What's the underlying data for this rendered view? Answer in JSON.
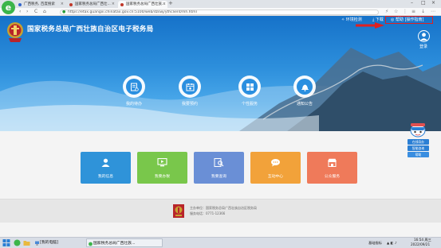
{
  "browser": {
    "tabs": [
      {
        "label": "广西税务, 百度搜索"
      },
      {
        "label": "国家税务总局广西壮..."
      },
      {
        "label": "国家税务总局广西壮族..."
      }
    ],
    "new_tab_glyph": "+",
    "url": "https://etax.guangxi.chinatax.gov.cn:5100/web/dzswj/ythclient/mh.html",
    "nav_back": "‹",
    "nav_forward": "›",
    "nav_reload": "C",
    "nav_home": "⌂"
  },
  "site": {
    "title": "国家税务总局广西壮族自治区电子税务局",
    "topnav": {
      "env_check": "环境检测",
      "download": "下载",
      "help": "帮助",
      "guide": "[操作指南]"
    },
    "login_label": "登录",
    "features": [
      {
        "label": "我的待办",
        "icon": "todo-list-icon"
      },
      {
        "label": "我要预约",
        "icon": "calendar-icon"
      },
      {
        "label": "个性服务",
        "icon": "grid-icon"
      },
      {
        "label": "通知公告",
        "icon": "bell-icon"
      }
    ],
    "cards": [
      {
        "label": "我的信息",
        "icon": "user-icon",
        "color": "#2f93d9"
      },
      {
        "label": "我要办税",
        "icon": "monitor-icon",
        "color": "#79c74b"
      },
      {
        "label": "我要查询",
        "icon": "search-icon",
        "color": "#6a8fd6"
      },
      {
        "label": "互动中心",
        "icon": "chat-icon",
        "color": "#f2a23a"
      },
      {
        "label": "公众服务",
        "icon": "shop-icon",
        "color": "#ef7a5a"
      }
    ],
    "side_float": [
      {
        "label": "在线导办"
      },
      {
        "label": "智能咨询"
      },
      {
        "label": "帮助"
      }
    ],
    "footer": {
      "host": "国家税务总局广西壮族自治区税务局",
      "host_label": "主办单位：",
      "phone_label": "服务电话：",
      "phone": "0771-12366"
    }
  },
  "taskbar": {
    "items": [
      {
        "label": "[我的电脑]"
      },
      {
        "label": "国家税务总局广西壮族..."
      }
    ],
    "tray_left": "基础指标",
    "time": "16:54 周三",
    "date": "2022/09/21"
  },
  "colors": {
    "hero_top": "#1672c9",
    "accent_red": "#e02020"
  }
}
